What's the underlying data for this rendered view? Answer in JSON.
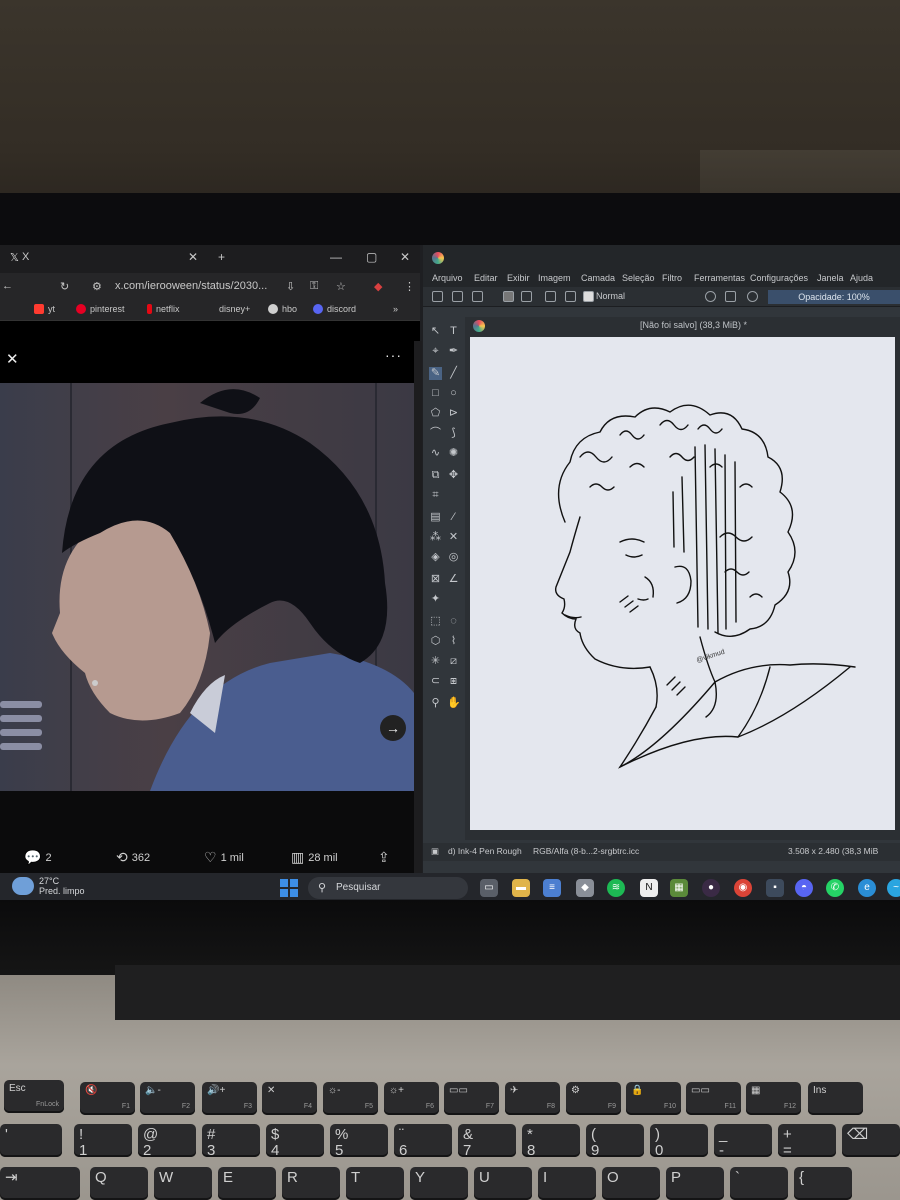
{
  "browser": {
    "tab_title": "X",
    "url": "x.com/ierooween/status/2030...",
    "bookmarks": [
      {
        "label": "yt",
        "icon": "youtube-icon",
        "color": "#ff3b30"
      },
      {
        "label": "pinterest",
        "icon": "pinterest-icon",
        "color": "#e60023"
      },
      {
        "label": "netflix",
        "icon": "netflix-icon",
        "color": "#e50914"
      },
      {
        "label": "disney+",
        "icon": "disney-plus-icon",
        "color": "#1e3a8a"
      },
      {
        "label": "hbo",
        "icon": "hbo-icon",
        "color": "#cfcfcf"
      },
      {
        "label": "discord",
        "icon": "discord-icon",
        "color": "#5865f2"
      }
    ],
    "post_actions": {
      "replies": "2",
      "reposts": "362",
      "likes": "1 mil",
      "views": "28 mil"
    }
  },
  "krita": {
    "menu": [
      "Arquivo",
      "Editar",
      "Exibir",
      "Imagem",
      "Camada",
      "Seleção",
      "Filtro",
      "Ferramentas",
      "Configurações",
      "Janela",
      "Ajuda"
    ],
    "blend_mode": "Normal",
    "opacity": "Opacidade: 100%",
    "document_title": "[Não foi salvo]  (38,3 MiB) *",
    "status_brush": "d) Ink-4 Pen Rough",
    "status_color": "RGB/Alfa (8-b...2-srgbtrc.icc",
    "status_size": "3.508 x 2.480 (38,3 MiB",
    "signature": "@vikmud"
  },
  "taskbar": {
    "temperature": "27°C",
    "weather_desc": "Pred. limpo",
    "search_placeholder": "Pesquisar"
  },
  "colors": {
    "krita_accent": "#3a4f6b",
    "windows_blue": "#3d8ee6"
  }
}
